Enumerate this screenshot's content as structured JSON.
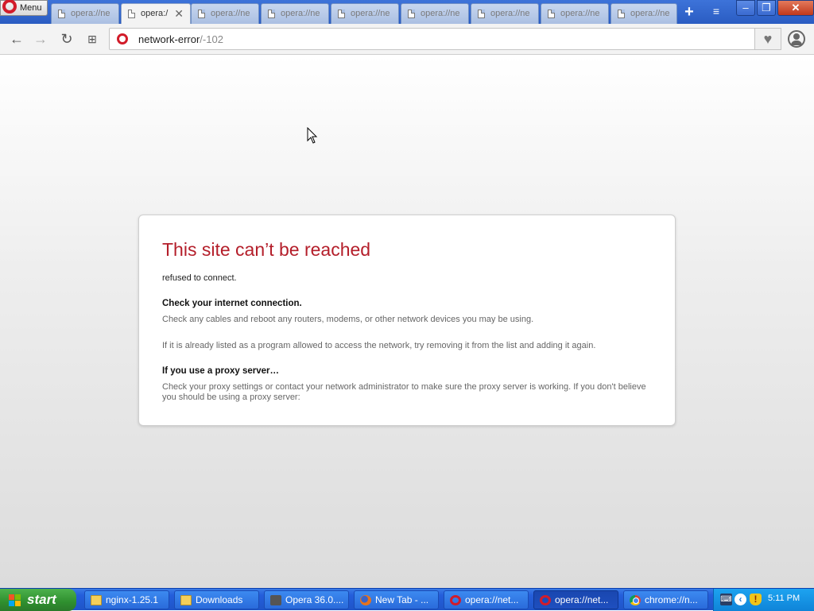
{
  "browser": {
    "menu_label": "Menu",
    "tabs": [
      {
        "label": "opera://ne",
        "active": false
      },
      {
        "label": "opera:/",
        "active": true,
        "close": "✕"
      },
      {
        "label": "opera://ne",
        "active": false
      },
      {
        "label": "opera://ne",
        "active": false
      },
      {
        "label": "opera://ne",
        "active": false
      },
      {
        "label": "opera://ne",
        "active": false
      },
      {
        "label": "opera://ne",
        "active": false
      },
      {
        "label": "opera://ne",
        "active": false
      },
      {
        "label": "opera://ne",
        "active": false
      }
    ],
    "new_tab_symbol": "+",
    "tab_menu_symbol": "≡",
    "window": {
      "minimize": "–",
      "maximize": "❐",
      "close": "✕"
    }
  },
  "toolbar": {
    "back": "←",
    "forward": "→",
    "reload": "↻",
    "speed_dial": "⊞",
    "url_host": "network-error",
    "url_path": "/-102",
    "heart": "♥"
  },
  "error": {
    "title": "This site can’t be reached",
    "subtitle": "refused to connect.",
    "section1_heading": "Check your internet connection.",
    "section1_text": "Check any cables and reboot any routers, modems, or other network devices you may be using.",
    "section1_text2": "If it is already listed as a program allowed to access the network, try removing it from the list and adding it again.",
    "section2_heading": "If you use a proxy server…",
    "section2_text": "Check your proxy settings or contact your network administrator to make sure the proxy server is working. If you don't believe you should be using a proxy server:"
  },
  "taskbar": {
    "start_label": "start",
    "tasks": [
      {
        "label": "nginx-1.25.1",
        "icon": "folder-icon",
        "active": false
      },
      {
        "label": "Downloads",
        "icon": "folder-icon",
        "active": false
      },
      {
        "label": "Opera 36.0....",
        "icon": "opera-setup-icon",
        "active": false
      },
      {
        "label": "New Tab - ...",
        "icon": "firefox-icon",
        "active": false
      },
      {
        "label": "opera://net...",
        "icon": "opera-icon",
        "active": false
      },
      {
        "label": "opera://net...",
        "icon": "opera-icon",
        "active": true
      },
      {
        "label": "chrome://n...",
        "icon": "chrome-icon",
        "active": false
      }
    ],
    "tray": {
      "keyboard": "⌨",
      "arrow": "‹",
      "shield": "!",
      "clock": "5:11 PM"
    }
  },
  "colors": {
    "error_title": "#b41e2a",
    "opera_red": "#d21c2a",
    "taskbar_blue": "#245edb",
    "start_green": "#2f8f2f"
  }
}
